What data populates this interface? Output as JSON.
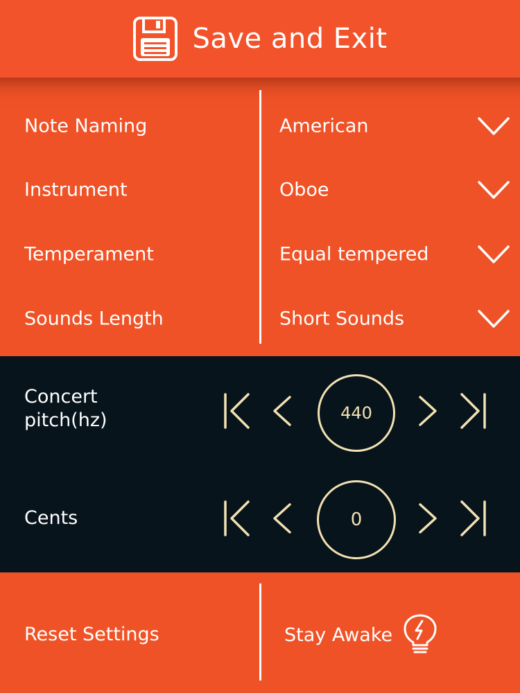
{
  "header": {
    "title": "Save and Exit",
    "icon": "floppy-disk-icon"
  },
  "settings": [
    {
      "label": "Note Naming",
      "value": "American"
    },
    {
      "label": "Instrument",
      "value": "Oboe"
    },
    {
      "label": "Temperament",
      "value": "Equal tempered"
    },
    {
      "label": "Sounds Length",
      "value": "Short Sounds"
    }
  ],
  "controls": {
    "concert_pitch": {
      "label_line1": "Concert",
      "label_line2": "pitch(hz)",
      "value": "440"
    },
    "cents": {
      "label": "Cents",
      "value": "0"
    }
  },
  "footer": {
    "reset_label": "Reset Settings",
    "stay_awake_label": "Stay Awake",
    "stay_awake_icon": "lightbulb-bolt-icon"
  },
  "colors": {
    "orange": "#ef5226",
    "dark_panel": "#08141c",
    "cream": "#f2e2b2",
    "white": "#ffffff"
  }
}
